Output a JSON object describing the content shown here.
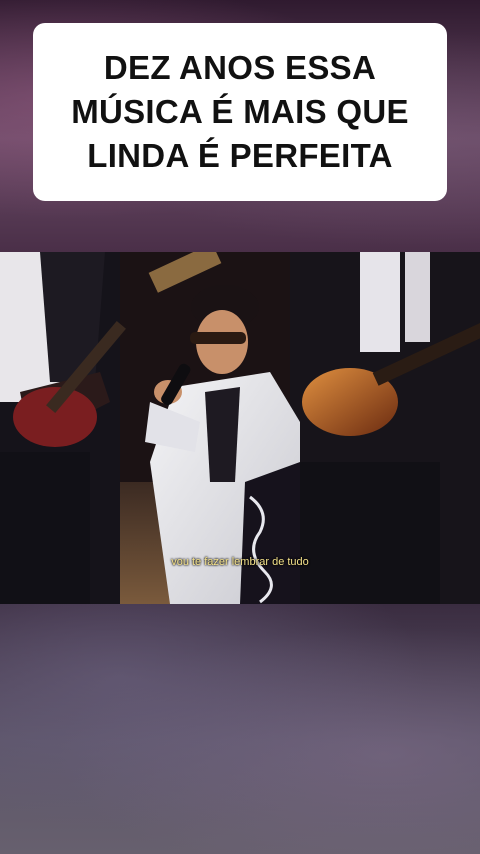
{
  "overlay": {
    "caption_lines": [
      "DEZ ANOS ESSA",
      "MÚSICA É MAIS QUE",
      "LINDA É PERFEITA"
    ]
  },
  "video": {
    "subtitle": "vou te fazer lembrar de tudo"
  },
  "colors": {
    "caption_bg": "#ffffff",
    "caption_text": "#111111",
    "subtitle_text": "#f3e08a"
  }
}
